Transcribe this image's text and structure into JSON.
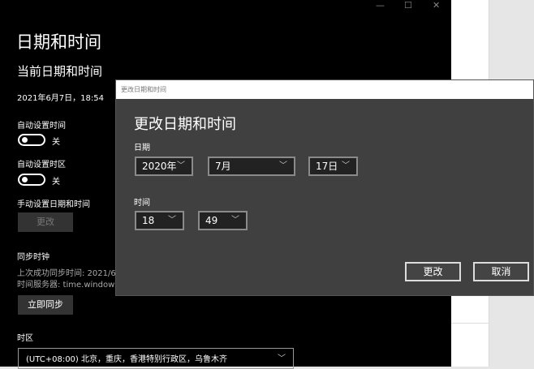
{
  "settings": {
    "page_title": "日期和时间",
    "section_current": "当前日期和时间",
    "current_datetime": "2021年6月7日，18:54",
    "auto_time_label": "自动设置时间",
    "auto_time_state": "关",
    "auto_timezone_label": "自动设置时区",
    "auto_timezone_state": "关",
    "manual_label": "手动设置日期和时间",
    "manual_button": "更改",
    "sync_title": "同步时钟",
    "last_sync": "上次成功同步时间: 2021/6",
    "time_server": "时间服务器: time.windows",
    "sync_button": "立即同步",
    "timezone_title": "时区",
    "timezone_value": "(UTC+08:00) 北京，重庆，香港特别行政区，乌鲁木齐"
  },
  "window_controls": {
    "minimize": "—",
    "maximize": "☐",
    "close": "✕"
  },
  "dialog": {
    "titlebar": "更改日期和时间",
    "heading": "更改日期和时间",
    "date_label": "日期",
    "year": "2020年",
    "month": "7月",
    "day": "17日",
    "time_label": "时间",
    "hour": "18",
    "minute": "49",
    "change_button": "更改",
    "cancel_button": "取消"
  },
  "icons": {
    "chevron": "﹀"
  }
}
